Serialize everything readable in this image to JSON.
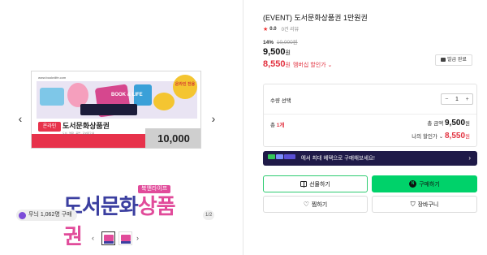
{
  "gallery": {
    "prev_arrow": "‹",
    "next_arrow": "›",
    "voucher": {
      "url": "www.booknlife.com",
      "badge": "온라인 전용",
      "art_text": "BOOK & LIFE",
      "pill": "온라인",
      "name": "도서문화상품권",
      "subtext": "도서 · 영화 · 공연 · 교보문고 외",
      "amount": "10,000"
    },
    "brand": {
      "tag": "북앤라이프",
      "main_part1": "도서문화",
      "main_part2": "상품권"
    },
    "buyers_chip": "무늬 1,062명 구매",
    "page_indicator": "1/2",
    "thumb_prev": "‹",
    "thumb_next": "›"
  },
  "product": {
    "title": "(EVENT) 도서문화상품권 1만원권",
    "rating_star": "★",
    "rating_score": "0.0",
    "review_count": "0건 리뷰",
    "discount_percent": "14%",
    "original_price": "10,000원",
    "sale_price": "9,500",
    "sale_price_unit": "원",
    "member_price": "8,550",
    "member_price_unit": "원",
    "member_label": "멤버십 할인가 ⌄",
    "issue_button": "발급 완료"
  },
  "options": {
    "qty_label": "수량 선택",
    "minus": "−",
    "quantity": "1",
    "plus": "+",
    "count_prefix": "총",
    "count_value": "1개",
    "total_label": "총 금액",
    "total_value": "9,500",
    "total_unit": "원",
    "my_discount_label": "나의 할인가 ⌄",
    "my_discount_value": "8,550",
    "my_discount_unit": "원"
  },
  "promo": {
    "text": "에서 최대 혜택으로 구매해보세요!",
    "chevron": "›"
  },
  "actions": {
    "gift": "선물하기",
    "buy": "구매하기",
    "buy_icon": "N",
    "wish": "찜하기",
    "cart": "장바구니"
  },
  "colors": {
    "accent_green": "#00d26a",
    "price_red": "#e2313f",
    "promo_navy": "#1f1a48",
    "brand_navy": "#3b3fa0",
    "brand_pink": "#e14b9a"
  }
}
